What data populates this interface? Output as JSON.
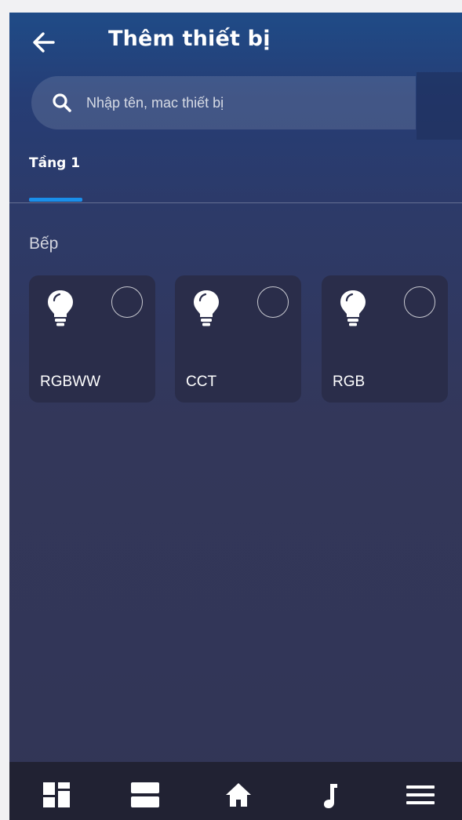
{
  "header": {
    "title": "Thêm thiết bị",
    "back_icon": "arrow-left-icon"
  },
  "search": {
    "placeholder": "Nhập tên, mac thiết bị",
    "value": "",
    "icon": "search-icon"
  },
  "tabs": [
    {
      "label": "Tầng 1",
      "active": true
    }
  ],
  "section": {
    "title": "Bếp"
  },
  "devices": [
    {
      "name": "RGBWW",
      "icon": "lightbulb-icon",
      "selected": false
    },
    {
      "name": "CCT",
      "icon": "lightbulb-icon",
      "selected": false
    },
    {
      "name": "RGB",
      "icon": "lightbulb-icon",
      "selected": false
    }
  ],
  "bottom_nav": [
    {
      "icon": "dashboard-icon"
    },
    {
      "icon": "scenes-icon"
    },
    {
      "icon": "home-icon"
    },
    {
      "icon": "music-icon"
    },
    {
      "icon": "menu-icon"
    }
  ],
  "colors": {
    "accent": "#1a8fea",
    "card": "#2a2d4a",
    "nav_bg": "#212233",
    "header_top": "#1f4b87",
    "background": "#323656"
  }
}
